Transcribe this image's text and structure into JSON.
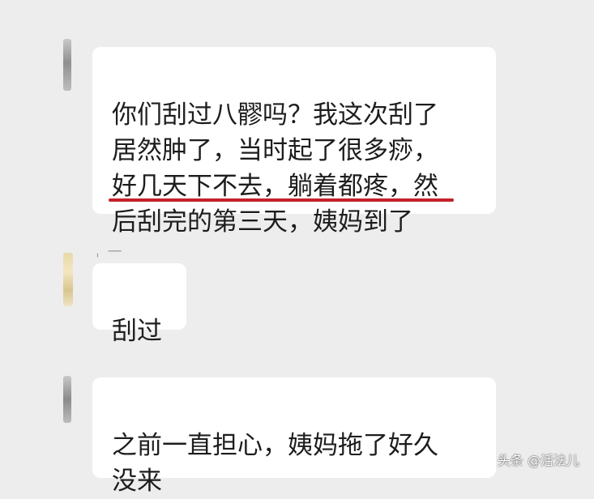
{
  "messages": [
    {
      "text": "你们刮过八髎吗？我这次刮了\n居然肿了，当时起了很多痧，\n好几天下不去，躺着都疼，然\n后刮完的第三天，姨妈到了"
    },
    {
      "text": "刮过"
    },
    {
      "text": "之前一直担心，姨妈拖了好久\n没来"
    }
  ],
  "sender_name_fragment": "ˌ —",
  "watermark": "头条 @活法儿",
  "colors": {
    "background": "#ededed",
    "bubble": "#ffffff",
    "underline": "#c2212a"
  }
}
